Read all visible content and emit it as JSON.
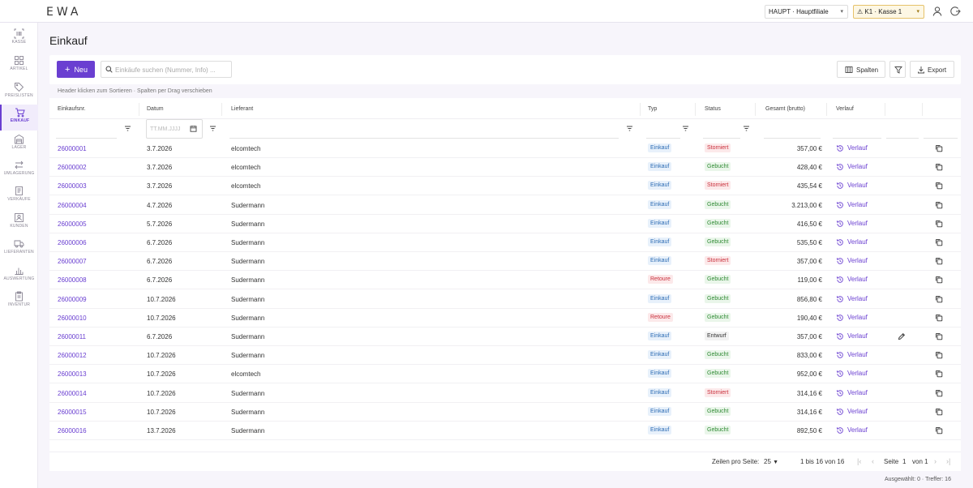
{
  "app": {
    "logo": "EWA"
  },
  "topbar": {
    "branch": "HAUPT · Hauptfiliale",
    "till": "⚠ K1 · Kasse 1",
    "user_icon": "user-icon",
    "logout_icon": "logout-icon"
  },
  "sidebar": {
    "items": [
      {
        "label": "KASSE",
        "icon": "barcode-icon"
      },
      {
        "label": "ARTIKEL",
        "icon": "grid-icon"
      },
      {
        "label": "PREISLISTEN",
        "icon": "tag-icon"
      },
      {
        "label": "EINKAUF",
        "icon": "cart-icon",
        "active": true
      },
      {
        "label": "LAGER",
        "icon": "warehouse-icon"
      },
      {
        "label": "UMLAGERUNG",
        "icon": "transfer-icon"
      },
      {
        "label": "VERKÄUFE",
        "icon": "receipt-icon"
      },
      {
        "label": "KUNDEN",
        "icon": "customers-icon"
      },
      {
        "label": "LIEFERANTEN",
        "icon": "truck-icon"
      },
      {
        "label": "AUSWERTUNG",
        "icon": "chart-icon"
      },
      {
        "label": "INVENTUR",
        "icon": "clipboard-icon"
      }
    ]
  },
  "page": {
    "title": "Einkauf"
  },
  "toolbar": {
    "new_label": "Neu",
    "search_placeholder": "Einkäufe suchen (Nummer, Info) ...",
    "columns_label": "Spalten",
    "export_label": "Export"
  },
  "hint": "Header klicken zum Sortieren · Spalten per Drag verschieben",
  "table": {
    "columns": [
      "Einkaufsnr.",
      "Datum",
      "Lieferant",
      "Typ",
      "Status",
      "Gesamt (brutto)",
      "Verlauf"
    ],
    "date_placeholder": "TT.MM.JJJJ",
    "verlauf_label": "Verlauf",
    "rows": [
      {
        "nr": "26000001",
        "datum": "3.7.2026",
        "lieferant": "elcomtech",
        "typ": "Einkauf",
        "status": "Storniert",
        "gesamt": "357,00 €"
      },
      {
        "nr": "26000002",
        "datum": "3.7.2026",
        "lieferant": "elcomtech",
        "typ": "Einkauf",
        "status": "Gebucht",
        "gesamt": "428,40 €"
      },
      {
        "nr": "26000003",
        "datum": "3.7.2026",
        "lieferant": "elcomtech",
        "typ": "Einkauf",
        "status": "Storniert",
        "gesamt": "435,54 €"
      },
      {
        "nr": "26000004",
        "datum": "4.7.2026",
        "lieferant": "Sudermann",
        "typ": "Einkauf",
        "status": "Gebucht",
        "gesamt": "3.213,00 €"
      },
      {
        "nr": "26000005",
        "datum": "5.7.2026",
        "lieferant": "Sudermann",
        "typ": "Einkauf",
        "status": "Gebucht",
        "gesamt": "416,50 €"
      },
      {
        "nr": "26000006",
        "datum": "6.7.2026",
        "lieferant": "Sudermann",
        "typ": "Einkauf",
        "status": "Gebucht",
        "gesamt": "535,50 €"
      },
      {
        "nr": "26000007",
        "datum": "6.7.2026",
        "lieferant": "Sudermann",
        "typ": "Einkauf",
        "status": "Storniert",
        "gesamt": "357,00 €"
      },
      {
        "nr": "26000008",
        "datum": "6.7.2026",
        "lieferant": "Sudermann",
        "typ": "Retoure",
        "status": "Gebucht",
        "gesamt": "119,00 €"
      },
      {
        "nr": "26000009",
        "datum": "10.7.2026",
        "lieferant": "Sudermann",
        "typ": "Einkauf",
        "status": "Gebucht",
        "gesamt": "856,80 €"
      },
      {
        "nr": "26000010",
        "datum": "10.7.2026",
        "lieferant": "Sudermann",
        "typ": "Retoure",
        "status": "Gebucht",
        "gesamt": "190,40 €"
      },
      {
        "nr": "26000011",
        "datum": "6.7.2026",
        "lieferant": "Sudermann",
        "typ": "Einkauf",
        "status": "Entwurf",
        "gesamt": "357,00 €",
        "editable": true
      },
      {
        "nr": "26000012",
        "datum": "10.7.2026",
        "lieferant": "Sudermann",
        "typ": "Einkauf",
        "status": "Gebucht",
        "gesamt": "833,00 €"
      },
      {
        "nr": "26000013",
        "datum": "10.7.2026",
        "lieferant": "elcomtech",
        "typ": "Einkauf",
        "status": "Gebucht",
        "gesamt": "952,00 €"
      },
      {
        "nr": "26000014",
        "datum": "10.7.2026",
        "lieferant": "Sudermann",
        "typ": "Einkauf",
        "status": "Storniert",
        "gesamt": "314,16 €"
      },
      {
        "nr": "26000015",
        "datum": "10.7.2026",
        "lieferant": "Sudermann",
        "typ": "Einkauf",
        "status": "Gebucht",
        "gesamt": "314,16 €"
      },
      {
        "nr": "26000016",
        "datum": "13.7.2026",
        "lieferant": "Sudermann",
        "typ": "Einkauf",
        "status": "Gebucht",
        "gesamt": "892,50 €"
      }
    ]
  },
  "pager": {
    "rows_per_page_label": "Zeilen pro Seite:",
    "rows_per_page": "25",
    "range": "1 bis 16 von 16",
    "page_label": "Seite",
    "page": "1",
    "of_label": "von 1"
  },
  "footer": {
    "selection": "Ausgewählt: 0 · Treffer: 16"
  },
  "colors": {
    "accent": "#6a3fd1",
    "storniert": "#c92f3b",
    "gebucht": "#2f8a33",
    "einkauf": "#2c6bb3"
  }
}
